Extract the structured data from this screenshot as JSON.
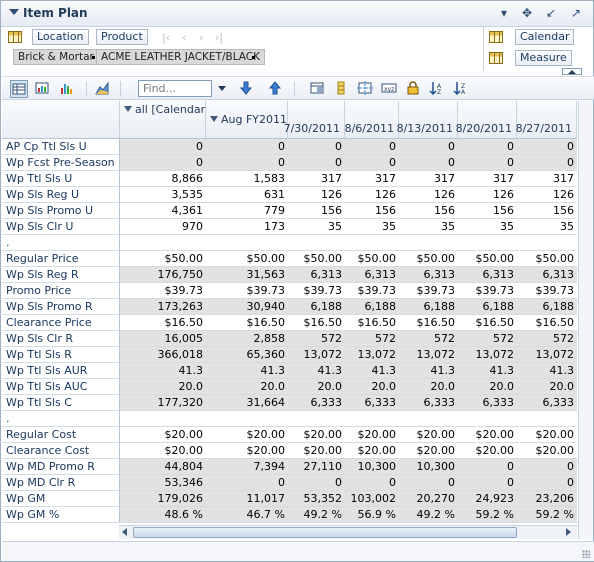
{
  "header": {
    "title": "Item Plan",
    "icons": [
      "collapse-icon",
      "menu-dropdown-icon",
      "move-icon",
      "minimize-icon",
      "maximize-icon"
    ]
  },
  "edge": {
    "location_label": "Location",
    "product_label": "Product",
    "location_value": "Brick & Mortar",
    "product_value": "ACME LEATHER JACKET/BLACK",
    "calendar_label": "Calendar",
    "measure_label": "Measure"
  },
  "toolbar": {
    "find_placeholder": "Find..."
  },
  "columns": {
    "all_label": "all [Calendar]",
    "month_label": "Aug FY2011",
    "dates": [
      "7/30/2011",
      "8/6/2011",
      "8/13/2011",
      "8/20/2011",
      "8/27/2011"
    ]
  },
  "rows": [
    {
      "label": "AP Cp Ttl Sls U",
      "shade": true,
      "values": [
        "0",
        "0",
        "0",
        "0",
        "0",
        "0",
        "0"
      ]
    },
    {
      "label": "Wp Fcst Pre-Season U",
      "shade": true,
      "values": [
        "0",
        "0",
        "0",
        "0",
        "0",
        "0",
        "0"
      ]
    },
    {
      "label": "Wp Ttl Sls U",
      "shade": false,
      "values": [
        "8,866",
        "1,583",
        "317",
        "317",
        "317",
        "317",
        "317"
      ]
    },
    {
      "label": "Wp Sls Reg U",
      "shade": false,
      "values": [
        "3,535",
        "631",
        "126",
        "126",
        "126",
        "126",
        "126"
      ]
    },
    {
      "label": "Wp Sls Promo U",
      "shade": false,
      "values": [
        "4,361",
        "779",
        "156",
        "156",
        "156",
        "156",
        "156"
      ]
    },
    {
      "label": "Wp Sls Clr U",
      "shade": false,
      "values": [
        "970",
        "173",
        "35",
        "35",
        "35",
        "35",
        "35"
      ]
    },
    {
      "label": ".",
      "shade": false,
      "values": [
        "",
        "",
        "",
        "",
        "",
        "",
        ""
      ]
    },
    {
      "label": "Regular Price",
      "shade": false,
      "values": [
        "$50.00",
        "$50.00",
        "$50.00",
        "$50.00",
        "$50.00",
        "$50.00",
        "$50.00"
      ]
    },
    {
      "label": "Wp Sls Reg R",
      "shade": true,
      "values": [
        "176,750",
        "31,563",
        "6,313",
        "6,313",
        "6,313",
        "6,313",
        "6,313"
      ]
    },
    {
      "label": "Promo Price",
      "shade": false,
      "values": [
        "$39.73",
        "$39.73",
        "$39.73",
        "$39.73",
        "$39.73",
        "$39.73",
        "$39.73"
      ]
    },
    {
      "label": "Wp Sls Promo R",
      "shade": true,
      "values": [
        "173,263",
        "30,940",
        "6,188",
        "6,188",
        "6,188",
        "6,188",
        "6,188"
      ]
    },
    {
      "label": "Clearance Price",
      "shade": false,
      "values": [
        "$16.50",
        "$16.50",
        "$16.50",
        "$16.50",
        "$16.50",
        "$16.50",
        "$16.50"
      ]
    },
    {
      "label": "Wp Sls Clr R",
      "shade": true,
      "values": [
        "16,005",
        "2,858",
        "572",
        "572",
        "572",
        "572",
        "572"
      ]
    },
    {
      "label": "Wp Ttl Sls R",
      "shade": true,
      "values": [
        "366,018",
        "65,360",
        "13,072",
        "13,072",
        "13,072",
        "13,072",
        "13,072"
      ]
    },
    {
      "label": "Wp Ttl Sls AUR",
      "shade": true,
      "values": [
        "41.3",
        "41.3",
        "41.3",
        "41.3",
        "41.3",
        "41.3",
        "41.3"
      ]
    },
    {
      "label": "Wp Ttl Sls AUC",
      "shade": true,
      "values": [
        "20.0",
        "20.0",
        "20.0",
        "20.0",
        "20.0",
        "20.0",
        "20.0"
      ]
    },
    {
      "label": "Wp Ttl Sls C",
      "shade": true,
      "values": [
        "177,320",
        "31,664",
        "6,333",
        "6,333",
        "6,333",
        "6,333",
        "6,333"
      ]
    },
    {
      "label": ".",
      "shade": false,
      "values": [
        "",
        "",
        "",
        "",
        "",
        "",
        ""
      ]
    },
    {
      "label": "Regular Cost",
      "shade": false,
      "values": [
        "$20.00",
        "$20.00",
        "$20.00",
        "$20.00",
        "$20.00",
        "$20.00",
        "$20.00"
      ]
    },
    {
      "label": "Clearance Cost",
      "shade": false,
      "values": [
        "$20.00",
        "$20.00",
        "$20.00",
        "$20.00",
        "$20.00",
        "$20.00",
        "$20.00"
      ]
    },
    {
      "label": "Wp MD Promo R",
      "shade": true,
      "values": [
        "44,804",
        "7,394",
        "27,110",
        "10,300",
        "10,300",
        "0",
        "0"
      ]
    },
    {
      "label": "Wp MD Clr R",
      "shade": true,
      "values": [
        "53,346",
        "0",
        "0",
        "0",
        "0",
        "0",
        "0"
      ]
    },
    {
      "label": "Wp GM",
      "shade": true,
      "values": [
        "179,026",
        "11,017",
        "53,352",
        "103,002",
        "20,270",
        "24,923",
        "23,206"
      ]
    },
    {
      "label": "Wp GM %",
      "shade": true,
      "values": [
        "48.6 %",
        "46.7 %",
        "49.2 %",
        "56.9 %",
        "49.2 %",
        "59.2 %",
        "59.2 %"
      ]
    }
  ]
}
